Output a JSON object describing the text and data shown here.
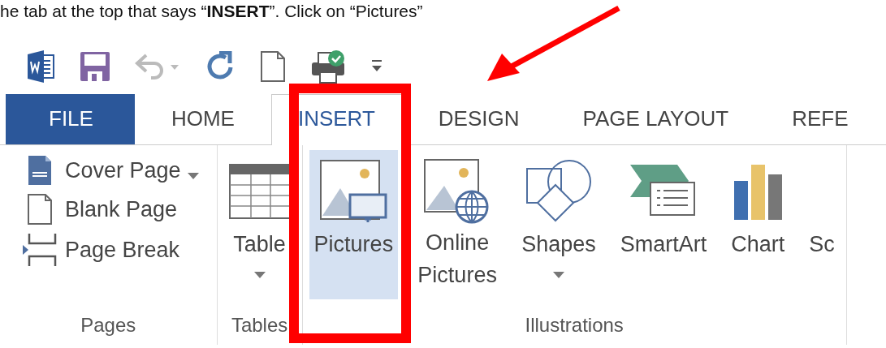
{
  "instruction": "he tab at the top that says “**INSERT**”. Click on “Pictures”",
  "quick_access": [
    {
      "kind": "word"
    },
    {
      "kind": "save"
    },
    {
      "kind": "undo"
    },
    {
      "kind": "redo"
    },
    {
      "kind": "new"
    },
    {
      "kind": "print"
    },
    {
      "kind": "customize"
    }
  ],
  "tabs": [
    {
      "label": "FILE",
      "kind": "file",
      "selected": false
    },
    {
      "label": "HOME",
      "kind": "normal",
      "selected": false
    },
    {
      "label": "INSERT",
      "kind": "normal",
      "selected": true
    },
    {
      "label": "DESIGN",
      "kind": "normal",
      "selected": false
    },
    {
      "label": "PAGE LAYOUT",
      "kind": "normal",
      "selected": false
    },
    {
      "label": "REFE",
      "kind": "normal",
      "selected": false
    }
  ],
  "groups": [
    {
      "label": "Pages",
      "buttons": [
        {
          "kind": "small",
          "label": "Cover Page",
          "dropdown": true
        },
        {
          "kind": "small",
          "label": "Blank Page",
          "dropdown": false
        },
        {
          "kind": "small",
          "label": "Page Break",
          "dropdown": false
        }
      ]
    },
    {
      "label": "Tables",
      "buttons": [
        {
          "kind": "large",
          "label": "Table",
          "dropdown": true,
          "selected": false
        }
      ]
    },
    {
      "label": "Illustrations",
      "buttons": [
        {
          "kind": "large",
          "label": "Pictures",
          "dropdown": false,
          "selected": true
        },
        {
          "kind": "large",
          "label": "Online Pictures",
          "dropdown": false,
          "selected": false
        },
        {
          "kind": "large",
          "label": "Shapes",
          "dropdown": true,
          "selected": false
        },
        {
          "kind": "large",
          "label": "SmartArt",
          "dropdown": false,
          "selected": false
        },
        {
          "kind": "large",
          "label": "Chart",
          "dropdown": false,
          "selected": false
        },
        {
          "kind": "large",
          "label": "Sc",
          "dropdown": false,
          "selected": false
        }
      ]
    }
  ]
}
